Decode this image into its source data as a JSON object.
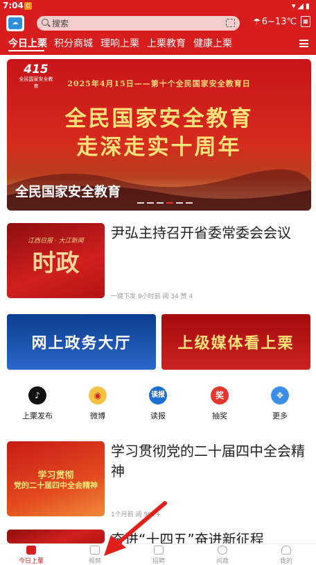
{
  "status_bar": {
    "time": "7:04",
    "app_badge": "C"
  },
  "header": {
    "search_placeholder": "搜索",
    "weather": {
      "temperature": "6~13℃",
      "icon": "cloud-rain-icon"
    },
    "tabs": [
      {
        "label": "今日上栗",
        "active": true
      },
      {
        "label": "积分商城",
        "active": false
      },
      {
        "label": "理响上栗",
        "active": false
      },
      {
        "label": "上栗教育",
        "active": false
      },
      {
        "label": "健康上栗",
        "active": false
      }
    ]
  },
  "banner": {
    "logo_number": "415",
    "logo_text": "全民国家安全教育",
    "subtitle": "2025年4月15日——第十个全民国家安全教育日",
    "headline_line1": "全民国家安全教育",
    "headline_line2": "走深走实十周年",
    "caption": "全民国家安全教育",
    "dots": 6,
    "active_dot": 4
  },
  "news": [
    {
      "title": "尹弘主持召开省委常委会会议",
      "thumb_script": "江西日报 · 大江新闻",
      "thumb_text": "时政",
      "meta": "一键下发  9小时前  阅 34  赞 4"
    },
    {
      "title": "学习贯彻党的二十届四中全会精神",
      "thumb_text_1": "学习贯彻",
      "thumb_text_2": "党的二十届四中全会精神",
      "meta": "1个月前  阅 907+"
    },
    {
      "title": "奋进“十四五”奋进新征程"
    }
  ],
  "promos": [
    {
      "label": "网上政务大厅",
      "color": "#1a4fa8"
    },
    {
      "label": "上级媒体看上栗",
      "color": "#b81515"
    }
  ],
  "shortcuts": [
    {
      "label": "上栗发布",
      "icon": "tiktok-icon",
      "color": "#111111"
    },
    {
      "label": "微博",
      "icon": "weibo-icon",
      "color": "#f5a623"
    },
    {
      "label": "读报",
      "icon": "newspaper-icon",
      "icon_text": "读报",
      "color": "#1c6fd1"
    },
    {
      "label": "抽奖",
      "icon": "lottery-icon",
      "icon_text": "奖",
      "color": "#e8352e"
    },
    {
      "label": "更多",
      "icon": "more-grid-icon",
      "color": "#3b8ee8"
    }
  ],
  "bottom_nav": [
    {
      "label": "今日上栗",
      "active": true
    },
    {
      "label": "视频",
      "active": false
    },
    {
      "label": "招聘",
      "active": false
    },
    {
      "label": "问政",
      "active": false
    },
    {
      "label": "我的",
      "active": false
    }
  ],
  "colors": {
    "brand_red": "#d71d1d",
    "gold": "#ffe37a",
    "annotation_arrow": "#e0201a"
  }
}
